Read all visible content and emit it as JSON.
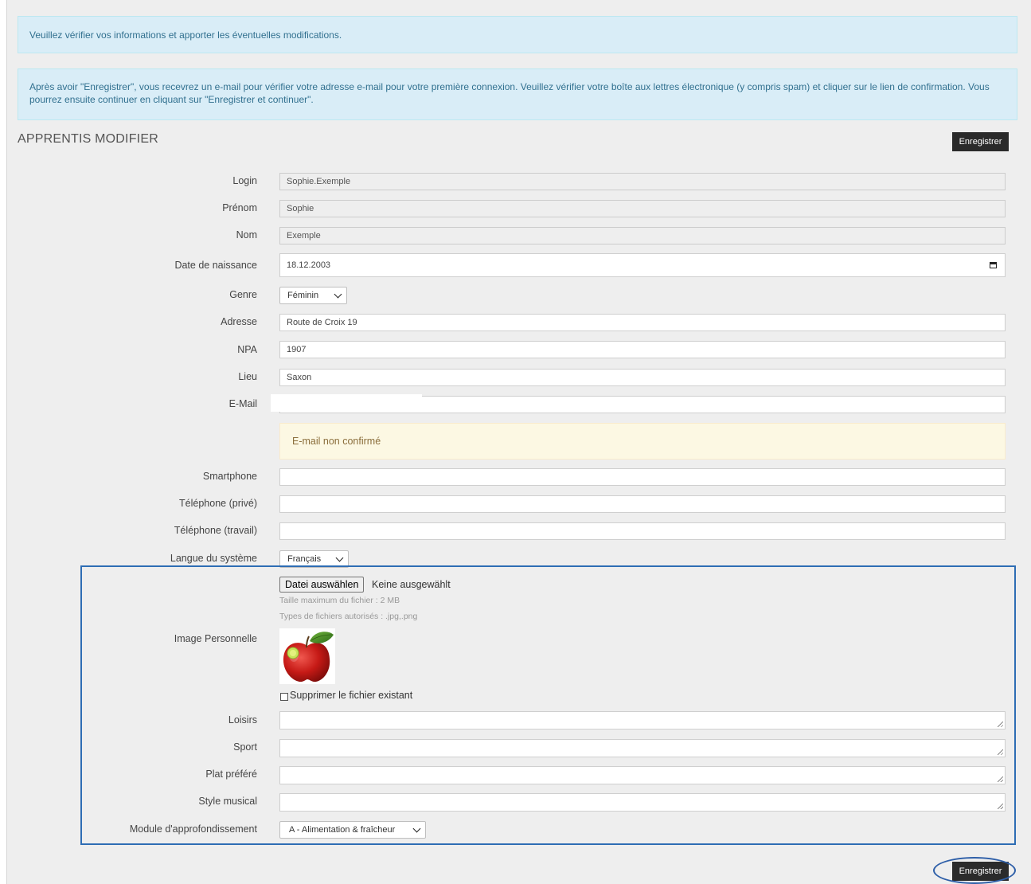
{
  "alerts": {
    "info1": "Veuillez vérifier vos informations et apporter les éventuelles modifications.",
    "info2": "Après avoir \"Enregistrer\", vous recevrez un e-mail pour vérifier votre adresse e-mail pour votre première connexion. Veuillez vérifier votre boîte aux lettres électronique (y compris spam) et cliquer sur le lien de confirmation. Vous pourrez ensuite continuer en cliquant sur \"Enregistrer et continuer\"."
  },
  "page": {
    "title": "APPRENTIS MODIFIER",
    "save_label": "Enregistrer"
  },
  "form": {
    "login": {
      "label": "Login",
      "value": "Sophie.Exemple"
    },
    "prenom": {
      "label": "Prénom",
      "value": "Sophie"
    },
    "nom": {
      "label": "Nom",
      "value": "Exemple"
    },
    "birthdate": {
      "label": "Date de naissance",
      "value": "18.12.2003"
    },
    "genre": {
      "label": "Genre",
      "value": "Féminin"
    },
    "adresse": {
      "label": "Adresse",
      "value": "Route de Croix 19"
    },
    "npa": {
      "label": "NPA",
      "value": "1907"
    },
    "lieu": {
      "label": "Lieu",
      "value": "Saxon"
    },
    "email": {
      "label": "E-Mail",
      "value": ""
    },
    "email_warning": "E-mail non confirmé",
    "smartphone": {
      "label": "Smartphone",
      "value": ""
    },
    "tel_prive": {
      "label": "Téléphone (privé)",
      "value": ""
    },
    "tel_travail": {
      "label": "Téléphone (travail)",
      "value": ""
    },
    "langue": {
      "label": "Langue du système",
      "value": "Français"
    },
    "image": {
      "label": "Image Personnelle",
      "button": "Datei auswählen",
      "status": "Keine ausgewählt",
      "max_size": "Taille maximum du fichier : 2 MB",
      "types": "Types de fichiers autorisés : .jpg,.png",
      "delete_label": "Supprimer le fichier existant"
    },
    "loisirs": {
      "label": "Loisirs",
      "value": ""
    },
    "sport": {
      "label": "Sport",
      "value": ""
    },
    "plat": {
      "label": "Plat préféré",
      "value": ""
    },
    "style": {
      "label": "Style musical",
      "value": ""
    },
    "module": {
      "label": "Module d'approfondissement",
      "value": "A - Alimentation & fraîcheur"
    }
  },
  "colors": {
    "info_bg": "#d9edf7",
    "warning_bg": "#fcf8e3",
    "button_bg": "#2b2b2b",
    "highlight": "#2e6db4"
  }
}
